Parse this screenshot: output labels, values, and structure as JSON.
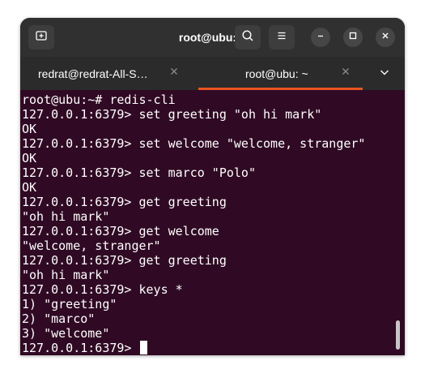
{
  "window": {
    "title": "root@ubu: ~"
  },
  "titlebar": {
    "new_tab_icon": "new-tab-icon",
    "search_icon": "search-icon",
    "menu_icon": "hamburger-menu-icon",
    "minimize_icon": "minimize-icon",
    "maximize_icon": "maximize-icon",
    "close_icon": "close-icon"
  },
  "tabs": [
    {
      "label": "redrat@redrat-All-S…",
      "active": false
    },
    {
      "label": "root@ubu: ~",
      "active": true
    }
  ],
  "colors": {
    "terminal_bg": "#300a24",
    "titlebar_bg": "#303030",
    "tabbar_bg": "#2b2b2b",
    "active_tab_accent": "#e95420",
    "text": "#ffffff"
  },
  "terminal": {
    "lines": [
      "root@ubu:~# redis-cli",
      "127.0.0.1:6379> set greeting \"oh hi mark\"",
      "OK",
      "127.0.0.1:6379> set welcome \"welcome, stranger\"",
      "OK",
      "127.0.0.1:6379> set marco \"Polo\"",
      "OK",
      "127.0.0.1:6379> get greeting",
      "\"oh hi mark\"",
      "127.0.0.1:6379> get welcome",
      "\"welcome, stranger\"",
      "127.0.0.1:6379> get greeting",
      "\"oh hi mark\"",
      "127.0.0.1:6379> keys *",
      "1) \"greeting\"",
      "2) \"marco\"",
      "3) \"welcome\""
    ],
    "prompt": "127.0.0.1:6379> "
  }
}
